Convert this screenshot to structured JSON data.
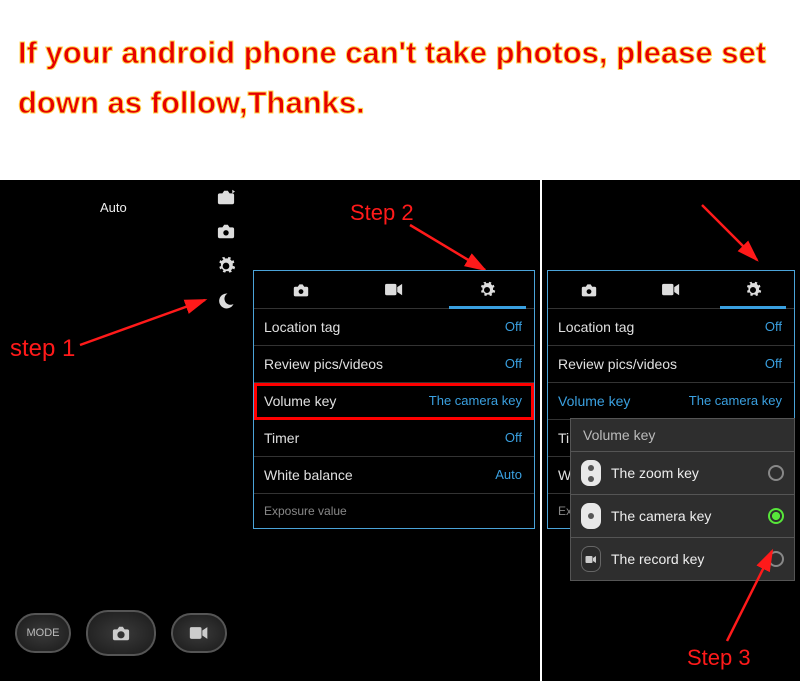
{
  "instruction": "If your android phone can't take photos, please set down as follow,Thanks.",
  "steps": {
    "s1": "step 1",
    "s2": "Step 2",
    "s3": "Step 3"
  },
  "left": {
    "auto": "Auto",
    "mode": "MODE"
  },
  "settings": {
    "rows": [
      {
        "label": "Location tag",
        "value": "Off"
      },
      {
        "label": "Review pics/videos",
        "value": "Off"
      },
      {
        "label": "Volume key",
        "value": "The camera key"
      },
      {
        "label": "Timer",
        "value": "Off"
      },
      {
        "label": "White balance",
        "value": "Auto"
      },
      {
        "label": "Exposure value",
        "value": ""
      }
    ]
  },
  "popup": {
    "title": "Volume key",
    "options": [
      {
        "label": "The zoom key"
      },
      {
        "label": "The camera key"
      },
      {
        "label": "The record key"
      }
    ]
  },
  "right_rows_cut": {
    "timer": "Timer",
    "white": "White",
    "expos": "Expos"
  }
}
